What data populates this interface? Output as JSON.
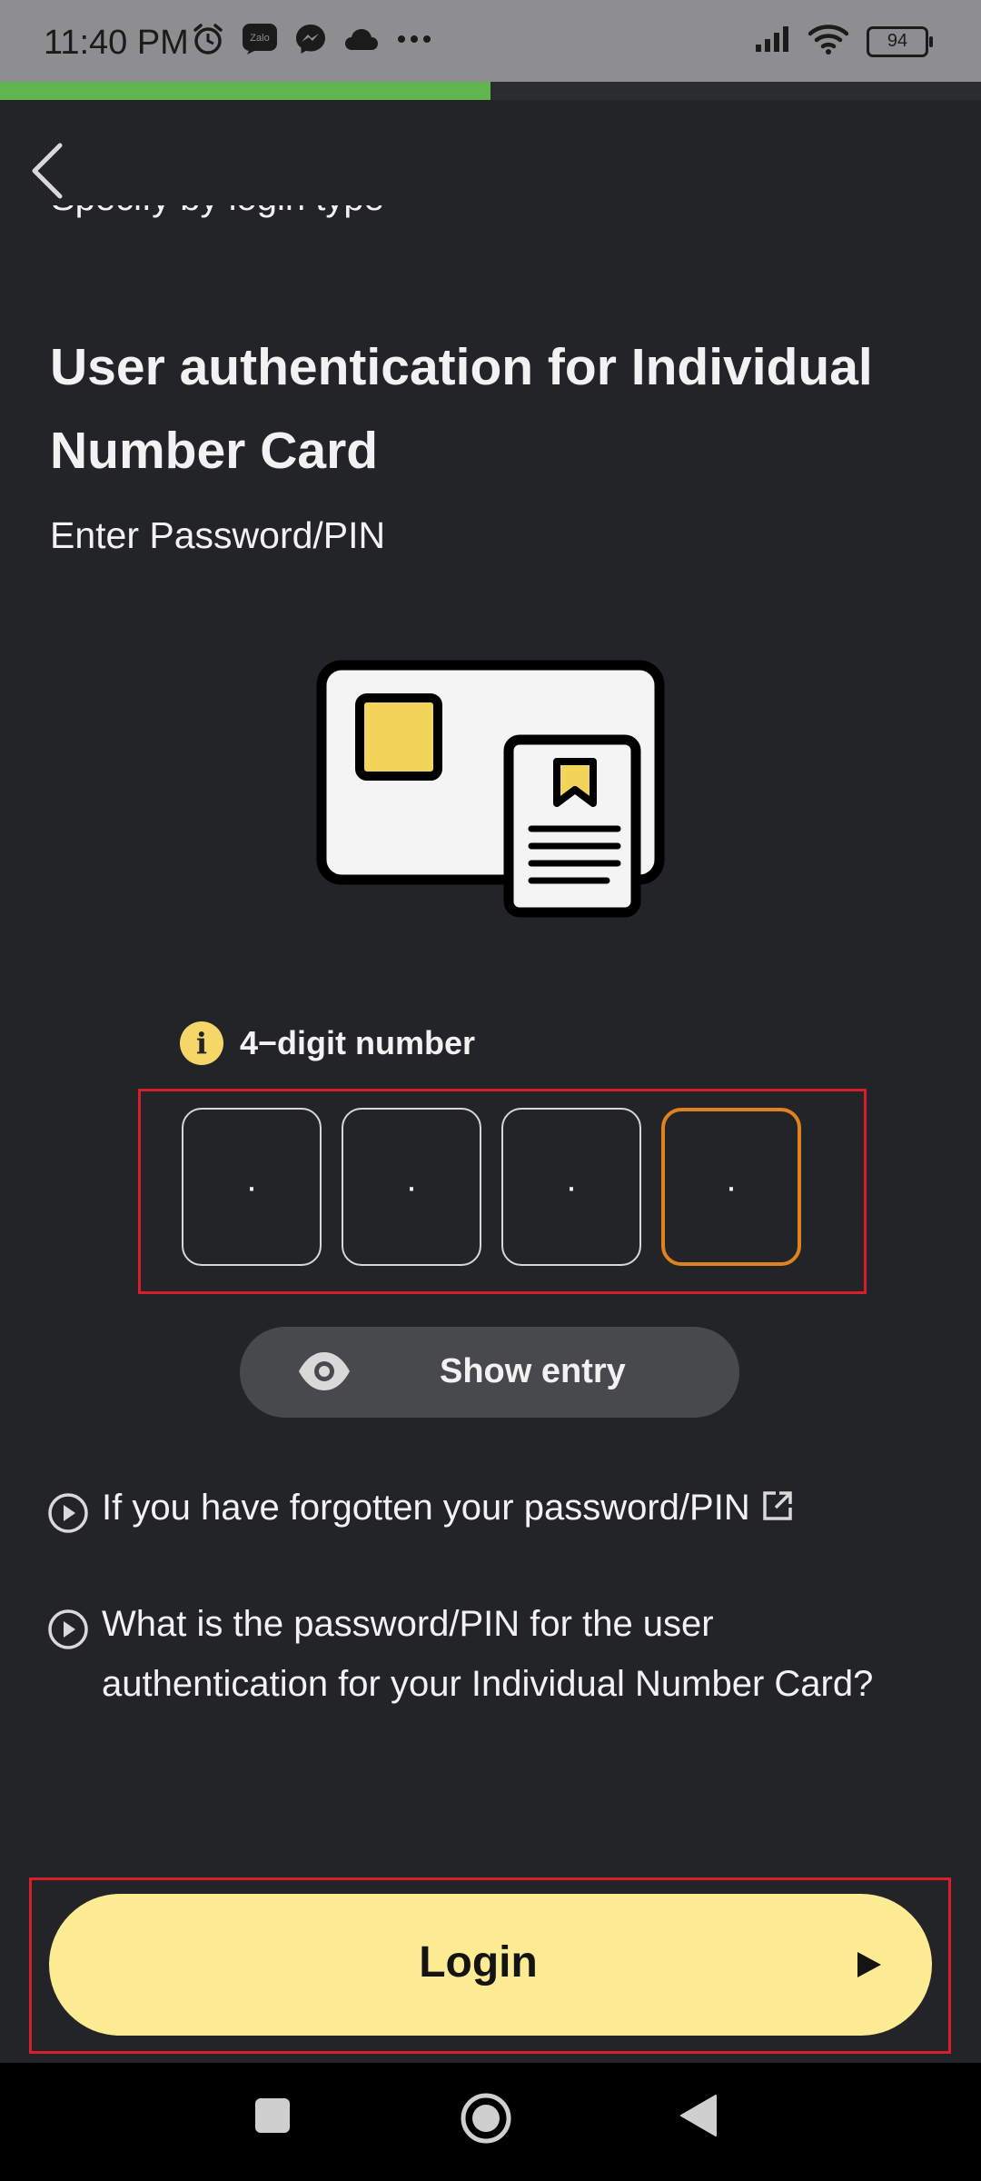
{
  "status_bar": {
    "time": "11:40 PM",
    "left_icons": [
      "alarm-icon",
      "zalo-icon",
      "messenger-icon",
      "cloud-icon",
      "more-icon"
    ],
    "zalo_text": "Zalo",
    "battery": "94"
  },
  "progress": 0.5,
  "header": {
    "back_icon": "back-chevron-icon"
  },
  "content": {
    "cut_text": "Specify by login type",
    "title": "User authentication for Individual Number Card",
    "subtitle": "Enter Password/PIN",
    "hint": "4−digit number",
    "pin_digits": [
      "·",
      "·",
      "·",
      "·"
    ],
    "show_entry_label": "Show entry",
    "links": [
      {
        "text": "If you have forgotten your password/PIN"
      },
      {
        "text": "What is the password/PIN for the user authentication for your Individual Number Card?"
      }
    ]
  },
  "login": {
    "label": "Login"
  },
  "colors": {
    "background": "#232427",
    "accent_green": "#61b54e",
    "login_yellow": "#fdeb93",
    "active_pin_orange": "#e0821f",
    "highlight_red": "#d61f2b",
    "info_yellow": "#f5d769"
  }
}
